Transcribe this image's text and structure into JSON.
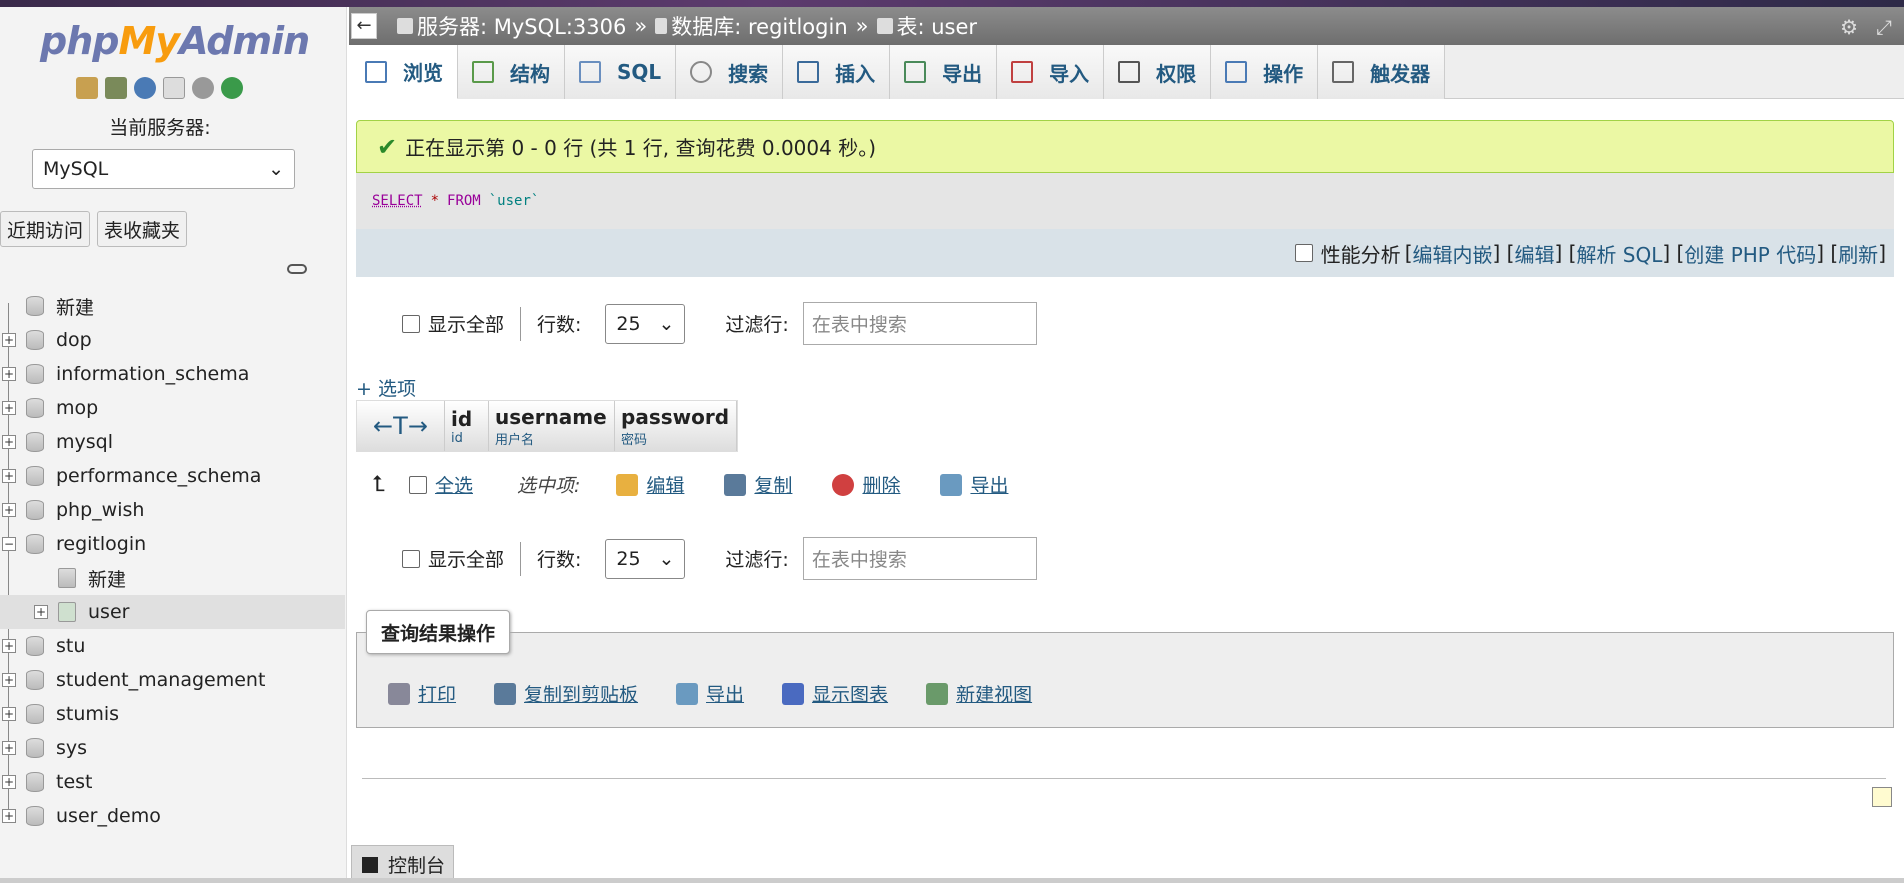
{
  "logo": {
    "part1": "php",
    "part2": "My",
    "part3": "Admin"
  },
  "sidebar": {
    "current_server_label": "当前服务器:",
    "server_select": "MySQL",
    "recent_btn": "近期访问",
    "fav_btn": "表收藏夹",
    "tree": [
      {
        "label": "新建",
        "type": "new"
      },
      {
        "label": "dop",
        "type": "db"
      },
      {
        "label": "information_schema",
        "type": "db"
      },
      {
        "label": "mop",
        "type": "db"
      },
      {
        "label": "mysql",
        "type": "db"
      },
      {
        "label": "performance_schema",
        "type": "db"
      },
      {
        "label": "php_wish",
        "type": "db"
      },
      {
        "label": "regitlogin",
        "type": "db-open"
      },
      {
        "label": "新建",
        "type": "sub-new"
      },
      {
        "label": "user",
        "type": "sub-table"
      },
      {
        "label": "stu",
        "type": "db"
      },
      {
        "label": "student_management",
        "type": "db"
      },
      {
        "label": "stumis",
        "type": "db"
      },
      {
        "label": "sys",
        "type": "db"
      },
      {
        "label": "test",
        "type": "db"
      },
      {
        "label": "user_demo",
        "type": "db"
      }
    ]
  },
  "breadcrumb": {
    "server": "服务器: MySQL:3306",
    "database": "数据库: regitlogin",
    "table": "表: user",
    "sep": "»"
  },
  "tabs": [
    {
      "label": "浏览",
      "icon": "browse-icon",
      "color": "#4a7ab5"
    },
    {
      "label": "结构",
      "icon": "structure-icon",
      "color": "#5a9a4a"
    },
    {
      "label": "SQL",
      "icon": "sql-icon",
      "color": "#6a8fbf"
    },
    {
      "label": "搜索",
      "icon": "search-icon",
      "color": "#888"
    },
    {
      "label": "插入",
      "icon": "insert-icon",
      "color": "#3a6a9a"
    },
    {
      "label": "导出",
      "icon": "export-icon",
      "color": "#4a8a5a"
    },
    {
      "label": "导入",
      "icon": "import-icon",
      "color": "#c04040"
    },
    {
      "label": "权限",
      "icon": "privileges-icon",
      "color": "#555"
    },
    {
      "label": "操作",
      "icon": "wrench-icon",
      "color": "#4a7ab5"
    },
    {
      "label": "触发器",
      "icon": "trigger-icon",
      "color": "#666"
    }
  ],
  "success_msg": "正在显示第 0 - 0 行 (共 1 行, 查询花费 0.0004 秒。)",
  "sql": {
    "select": "SELECT",
    "star": "*",
    "from": "FROM",
    "table": "`user`"
  },
  "sql_tools": {
    "profiling": "性能分析",
    "edit_inline": "编辑内嵌",
    "edit": "编辑",
    "explain": "解析 SQL",
    "create_php": "创建 PHP 代码",
    "refresh": "刷新"
  },
  "nav": {
    "show_all": "显示全部",
    "rows_label": "行数:",
    "rows_value": "25",
    "filter_label": "过滤行:",
    "filter_placeholder": "在表中搜索"
  },
  "options_link": "+ 选项",
  "columns": [
    {
      "name": "id",
      "comment": "id"
    },
    {
      "name": "username",
      "comment": "用户名"
    },
    {
      "name": "password",
      "comment": "密码"
    }
  ],
  "bulk": {
    "select_all": "全选",
    "with_selected": "选中项:",
    "edit": "编辑",
    "copy": "复制",
    "delete": "删除",
    "export": "导出"
  },
  "qr_ops": {
    "legend": "查询结果操作",
    "print": "打印",
    "copy_clip": "复制到剪贴板",
    "export": "导出",
    "chart": "显示图表",
    "new_view": "新建视图"
  },
  "console": "控制台"
}
